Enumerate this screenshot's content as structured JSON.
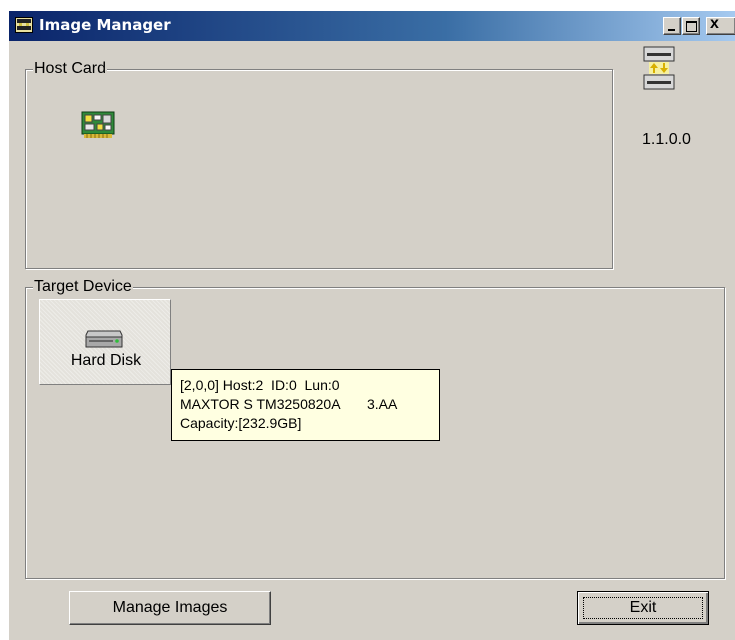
{
  "window": {
    "title": "Image Manager",
    "icon": "image-manager-icon"
  },
  "host_card": {
    "legend": "Host Card",
    "icon": "host-card-icon"
  },
  "version": {
    "icon": "server-sync-icon",
    "text": "1.1.0.0"
  },
  "target_device": {
    "legend": "Target Device",
    "devices": [
      {
        "label": "Hard Disk",
        "icon": "hard-disk-icon"
      }
    ]
  },
  "tooltip": {
    "lines": [
      "[2,0,0] Host:2  ID:0  Lun:0",
      "MAXTOR S TM3250820A       3.AA",
      "Capacity:[232.9GB]"
    ]
  },
  "buttons": {
    "manage_images": "Manage Images",
    "exit": "Exit"
  },
  "colors": {
    "window_bg": "#d4d0c8",
    "title_start": "#0a246a",
    "title_end": "#a6caf0",
    "tooltip_bg": "#ffffe1"
  }
}
